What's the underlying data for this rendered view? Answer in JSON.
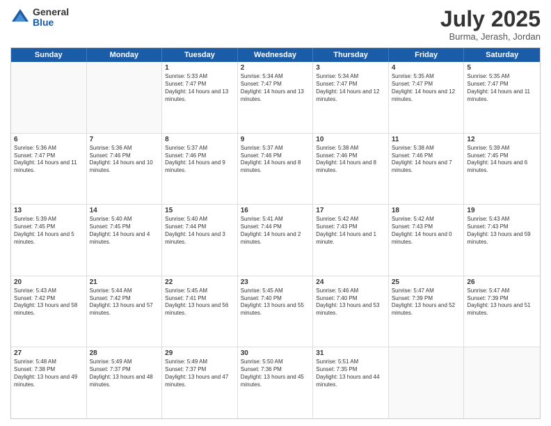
{
  "logo": {
    "general": "General",
    "blue": "Blue"
  },
  "title": {
    "month": "July 2025",
    "location": "Burma, Jerash, Jordan"
  },
  "header_days": [
    "Sunday",
    "Monday",
    "Tuesday",
    "Wednesday",
    "Thursday",
    "Friday",
    "Saturday"
  ],
  "weeks": [
    [
      {
        "day": "",
        "sunrise": "",
        "sunset": "",
        "daylight": ""
      },
      {
        "day": "",
        "sunrise": "",
        "sunset": "",
        "daylight": ""
      },
      {
        "day": "1",
        "sunrise": "Sunrise: 5:33 AM",
        "sunset": "Sunset: 7:47 PM",
        "daylight": "Daylight: 14 hours and 13 minutes."
      },
      {
        "day": "2",
        "sunrise": "Sunrise: 5:34 AM",
        "sunset": "Sunset: 7:47 PM",
        "daylight": "Daylight: 14 hours and 13 minutes."
      },
      {
        "day": "3",
        "sunrise": "Sunrise: 5:34 AM",
        "sunset": "Sunset: 7:47 PM",
        "daylight": "Daylight: 14 hours and 12 minutes."
      },
      {
        "day": "4",
        "sunrise": "Sunrise: 5:35 AM",
        "sunset": "Sunset: 7:47 PM",
        "daylight": "Daylight: 14 hours and 12 minutes."
      },
      {
        "day": "5",
        "sunrise": "Sunrise: 5:35 AM",
        "sunset": "Sunset: 7:47 PM",
        "daylight": "Daylight: 14 hours and 11 minutes."
      }
    ],
    [
      {
        "day": "6",
        "sunrise": "Sunrise: 5:36 AM",
        "sunset": "Sunset: 7:47 PM",
        "daylight": "Daylight: 14 hours and 11 minutes."
      },
      {
        "day": "7",
        "sunrise": "Sunrise: 5:36 AM",
        "sunset": "Sunset: 7:46 PM",
        "daylight": "Daylight: 14 hours and 10 minutes."
      },
      {
        "day": "8",
        "sunrise": "Sunrise: 5:37 AM",
        "sunset": "Sunset: 7:46 PM",
        "daylight": "Daylight: 14 hours and 9 minutes."
      },
      {
        "day": "9",
        "sunrise": "Sunrise: 5:37 AM",
        "sunset": "Sunset: 7:46 PM",
        "daylight": "Daylight: 14 hours and 8 minutes."
      },
      {
        "day": "10",
        "sunrise": "Sunrise: 5:38 AM",
        "sunset": "Sunset: 7:46 PM",
        "daylight": "Daylight: 14 hours and 8 minutes."
      },
      {
        "day": "11",
        "sunrise": "Sunrise: 5:38 AM",
        "sunset": "Sunset: 7:46 PM",
        "daylight": "Daylight: 14 hours and 7 minutes."
      },
      {
        "day": "12",
        "sunrise": "Sunrise: 5:39 AM",
        "sunset": "Sunset: 7:45 PM",
        "daylight": "Daylight: 14 hours and 6 minutes."
      }
    ],
    [
      {
        "day": "13",
        "sunrise": "Sunrise: 5:39 AM",
        "sunset": "Sunset: 7:45 PM",
        "daylight": "Daylight: 14 hours and 5 minutes."
      },
      {
        "day": "14",
        "sunrise": "Sunrise: 5:40 AM",
        "sunset": "Sunset: 7:45 PM",
        "daylight": "Daylight: 14 hours and 4 minutes."
      },
      {
        "day": "15",
        "sunrise": "Sunrise: 5:40 AM",
        "sunset": "Sunset: 7:44 PM",
        "daylight": "Daylight: 14 hours and 3 minutes."
      },
      {
        "day": "16",
        "sunrise": "Sunrise: 5:41 AM",
        "sunset": "Sunset: 7:44 PM",
        "daylight": "Daylight: 14 hours and 2 minutes."
      },
      {
        "day": "17",
        "sunrise": "Sunrise: 5:42 AM",
        "sunset": "Sunset: 7:43 PM",
        "daylight": "Daylight: 14 hours and 1 minute."
      },
      {
        "day": "18",
        "sunrise": "Sunrise: 5:42 AM",
        "sunset": "Sunset: 7:43 PM",
        "daylight": "Daylight: 14 hours and 0 minutes."
      },
      {
        "day": "19",
        "sunrise": "Sunrise: 5:43 AM",
        "sunset": "Sunset: 7:43 PM",
        "daylight": "Daylight: 13 hours and 59 minutes."
      }
    ],
    [
      {
        "day": "20",
        "sunrise": "Sunrise: 5:43 AM",
        "sunset": "Sunset: 7:42 PM",
        "daylight": "Daylight: 13 hours and 58 minutes."
      },
      {
        "day": "21",
        "sunrise": "Sunrise: 5:44 AM",
        "sunset": "Sunset: 7:42 PM",
        "daylight": "Daylight: 13 hours and 57 minutes."
      },
      {
        "day": "22",
        "sunrise": "Sunrise: 5:45 AM",
        "sunset": "Sunset: 7:41 PM",
        "daylight": "Daylight: 13 hours and 56 minutes."
      },
      {
        "day": "23",
        "sunrise": "Sunrise: 5:45 AM",
        "sunset": "Sunset: 7:40 PM",
        "daylight": "Daylight: 13 hours and 55 minutes."
      },
      {
        "day": "24",
        "sunrise": "Sunrise: 5:46 AM",
        "sunset": "Sunset: 7:40 PM",
        "daylight": "Daylight: 13 hours and 53 minutes."
      },
      {
        "day": "25",
        "sunrise": "Sunrise: 5:47 AM",
        "sunset": "Sunset: 7:39 PM",
        "daylight": "Daylight: 13 hours and 52 minutes."
      },
      {
        "day": "26",
        "sunrise": "Sunrise: 5:47 AM",
        "sunset": "Sunset: 7:39 PM",
        "daylight": "Daylight: 13 hours and 51 minutes."
      }
    ],
    [
      {
        "day": "27",
        "sunrise": "Sunrise: 5:48 AM",
        "sunset": "Sunset: 7:38 PM",
        "daylight": "Daylight: 13 hours and 49 minutes."
      },
      {
        "day": "28",
        "sunrise": "Sunrise: 5:49 AM",
        "sunset": "Sunset: 7:37 PM",
        "daylight": "Daylight: 13 hours and 48 minutes."
      },
      {
        "day": "29",
        "sunrise": "Sunrise: 5:49 AM",
        "sunset": "Sunset: 7:37 PM",
        "daylight": "Daylight: 13 hours and 47 minutes."
      },
      {
        "day": "30",
        "sunrise": "Sunrise: 5:50 AM",
        "sunset": "Sunset: 7:36 PM",
        "daylight": "Daylight: 13 hours and 45 minutes."
      },
      {
        "day": "31",
        "sunrise": "Sunrise: 5:51 AM",
        "sunset": "Sunset: 7:35 PM",
        "daylight": "Daylight: 13 hours and 44 minutes."
      },
      {
        "day": "",
        "sunrise": "",
        "sunset": "",
        "daylight": ""
      },
      {
        "day": "",
        "sunrise": "",
        "sunset": "",
        "daylight": ""
      }
    ]
  ]
}
